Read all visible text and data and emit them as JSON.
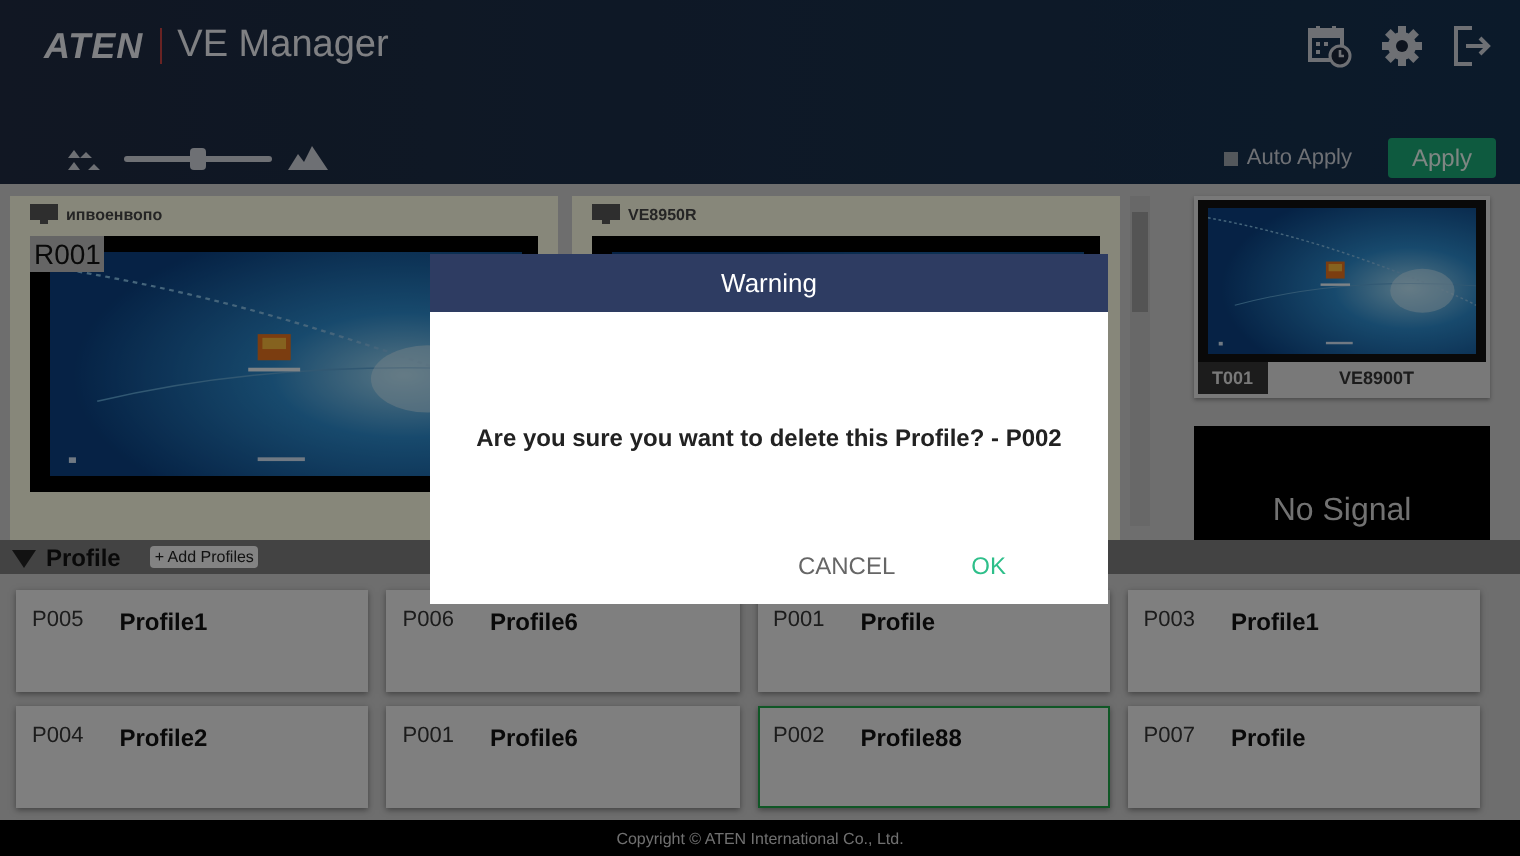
{
  "app": {
    "logo": "ATEN",
    "title": "VE Manager"
  },
  "toolbar": {
    "zoom_slider": {
      "level": 0.5
    },
    "auto_apply": {
      "label": "Auto Apply",
      "checked": false
    },
    "apply_button": "Apply"
  },
  "receivers": [
    {
      "name": "ипвоенвопо",
      "id": "R001",
      "kind": "video"
    },
    {
      "name": "VE8950R",
      "kind": "video"
    }
  ],
  "transmitters": [
    {
      "kind": "video",
      "id": "T001",
      "name": "VE8900T"
    },
    {
      "kind": "no_signal",
      "status": "No Signal"
    }
  ],
  "profile_bar": {
    "title": "Profile",
    "add_button": "+ Add Profiles",
    "expanded": true
  },
  "profiles": [
    {
      "id": "P005",
      "name": "Profile1",
      "selected": false
    },
    {
      "id": "P006",
      "name": "Profile6",
      "selected": false
    },
    {
      "id": "P001",
      "name": "Profile",
      "selected": false
    },
    {
      "id": "P003",
      "name": "Profile1",
      "selected": false
    },
    {
      "id": "P004",
      "name": "Profile2",
      "selected": false
    },
    {
      "id": "P001",
      "name": "Profile6",
      "selected": false
    },
    {
      "id": "P002",
      "name": "Profile88",
      "selected": true
    },
    {
      "id": "P007",
      "name": "Profile",
      "selected": false
    }
  ],
  "dialog": {
    "title": "Warning",
    "message": "Are you sure you want to delete this Profile? - P002",
    "buttons": [
      {
        "label": "CANCEL",
        "kind": "cancel"
      },
      {
        "label": "OK",
        "kind": "confirm"
      }
    ]
  },
  "footer": "Copyright © ATEN International Co., Ltd."
}
